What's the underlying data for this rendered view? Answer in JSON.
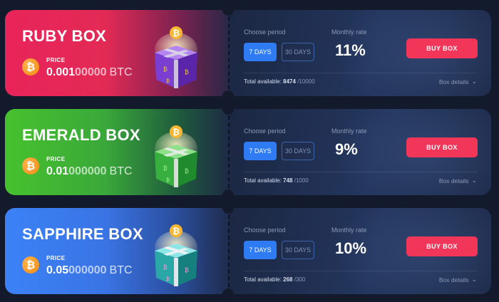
{
  "boxes": [
    {
      "title": "RUBY BOX",
      "price_label": "PRICE",
      "price_main": "0.001",
      "price_tail": "00000",
      "currency": "BTC",
      "coin_symbol": "₿",
      "choose_label": "Choose period",
      "period_active": "7 DAYS",
      "period_inactive": "30 DAYS",
      "rate_label": "Monthly rate",
      "rate_value": "11%",
      "buy_label": "BUY BOX",
      "available_label": "Total available:",
      "available": "8474",
      "available_total": "/10000",
      "details_label": "Box details",
      "accent": "#e8245a",
      "box_color": "#6a2bb8"
    },
    {
      "title": "EMERALD BOX",
      "price_label": "PRICE",
      "price_main": "0.01",
      "price_tail": "000000",
      "currency": "BTC",
      "coin_symbol": "₿",
      "choose_label": "Choose period",
      "period_active": "7 DAYS",
      "period_inactive": "30 DAYS",
      "rate_label": "Monthly rate",
      "rate_value": "9%",
      "buy_label": "BUY BOX",
      "available_label": "Total available:",
      "available": "748",
      "available_total": "/1000",
      "details_label": "Box details",
      "accent": "#47c12e",
      "box_color": "#2fa83a"
    },
    {
      "title": "SAPPHIRE BOX",
      "price_label": "PRICE",
      "price_main": "0.05",
      "price_tail": "000000",
      "currency": "BTC",
      "coin_symbol": "₿",
      "choose_label": "Choose period",
      "period_active": "7 DAYS",
      "period_inactive": "30 DAYS",
      "rate_label": "Monthly rate",
      "rate_value": "10%",
      "buy_label": "BUY BOX",
      "available_label": "Total available:",
      "available": "268",
      "available_total": "/300",
      "details_label": "Box details",
      "accent": "#3b82f6",
      "box_color": "#1f9c9c"
    }
  ],
  "colors": {
    "background": "#121a2b",
    "buy_button": "#f2365a",
    "period_active": "#2f7bf3",
    "btc_orange": "#f7931a"
  }
}
